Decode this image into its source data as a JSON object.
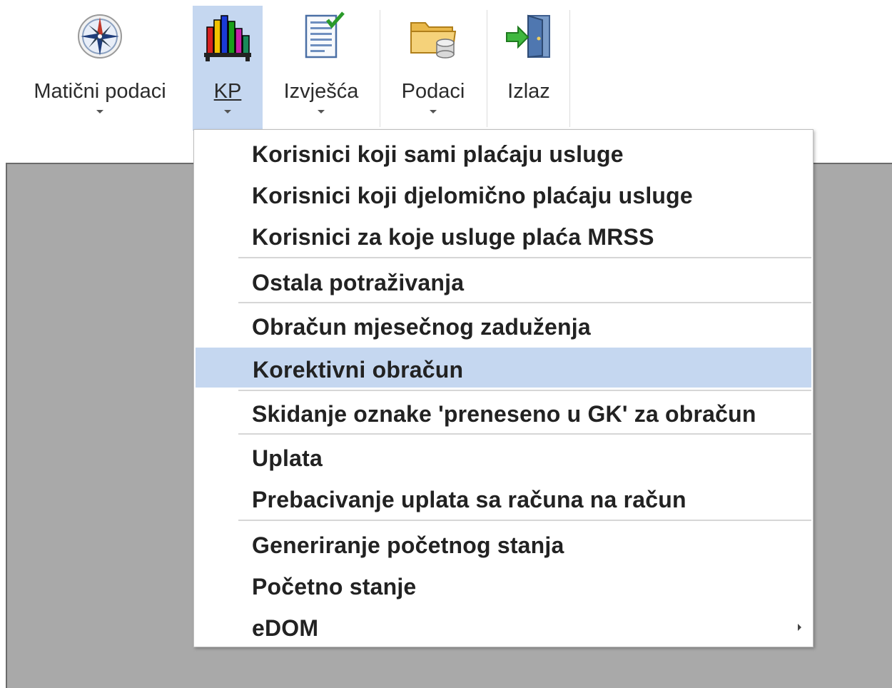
{
  "ribbon": {
    "buttons": [
      {
        "label": "Matični podaci",
        "icon": "compass-icon"
      },
      {
        "label": "KP",
        "icon": "bar-chart-icon"
      },
      {
        "label": "Izvješća",
        "icon": "report-icon"
      },
      {
        "label": "Podaci",
        "icon": "folder-database-icon"
      },
      {
        "label": "Izlaz",
        "icon": "exit-door-icon"
      }
    ]
  },
  "menu": {
    "items": [
      {
        "label": "Korisnici koji sami plaćaju usluge"
      },
      {
        "label": "Korisnici koji djelomično plaćaju usluge"
      },
      {
        "label": "Korisnici za koje usluge plaća MRSS"
      },
      {
        "label": "Ostala potraživanja"
      },
      {
        "label": "Obračun mjesečnog zaduženja"
      },
      {
        "label": "Korektivni obračun",
        "highlighted": true
      },
      {
        "label": "Skidanje oznake 'preneseno u GK' za obračun"
      },
      {
        "label": "Uplata"
      },
      {
        "label": "Prebacivanje uplata sa računa na račun"
      },
      {
        "label": "Generiranje početnog stanja"
      },
      {
        "label": "Početno stanje"
      },
      {
        "label": "eDOM",
        "submenu": true
      }
    ]
  },
  "colors": {
    "highlight": "#c5d7f0",
    "workspace": "#a9a9a9"
  }
}
